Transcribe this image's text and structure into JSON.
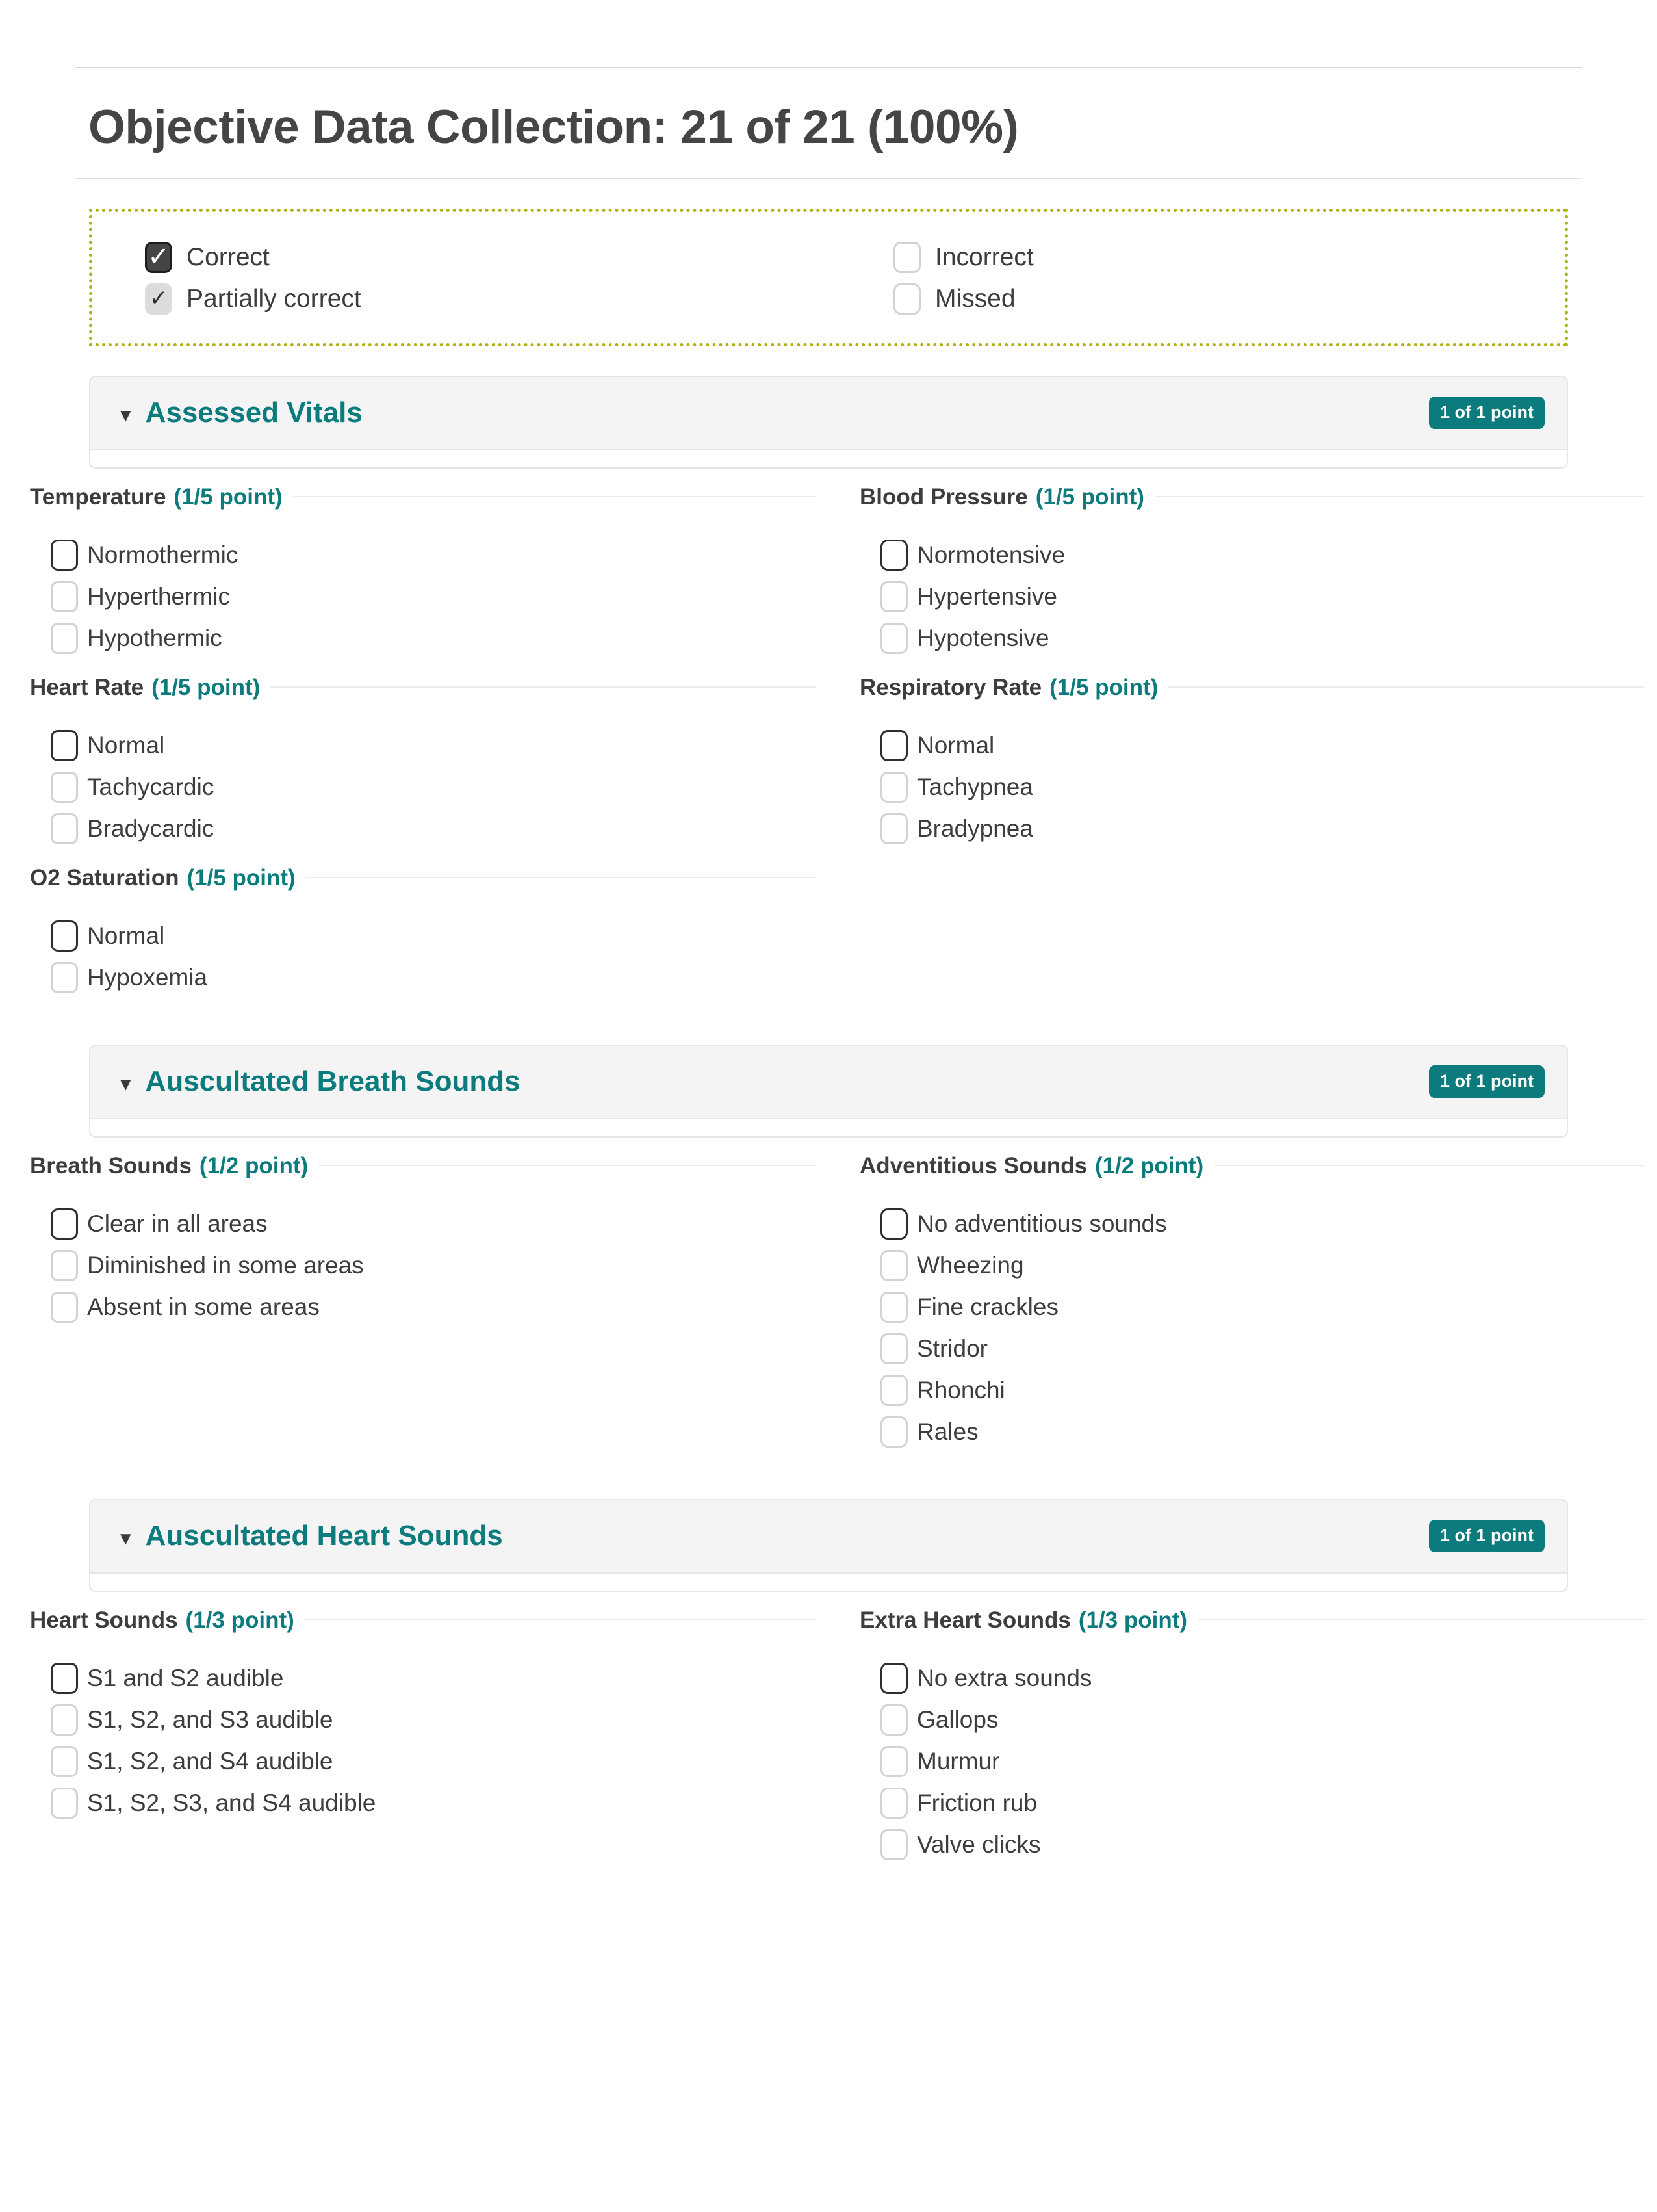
{
  "page": {
    "title": "Objective Data Collection: 21 of 21 (100%)"
  },
  "colors": {
    "accent_teal": "#0c7b7d",
    "legend_border_olive": "#b0b012",
    "panel_gray": "#f4f4f4",
    "text_dark": "#3d3d3d"
  },
  "legend": {
    "items": [
      {
        "label": "Correct",
        "state": "correct",
        "icon": "checkbox-checked-icon"
      },
      {
        "label": "Partially correct",
        "state": "partial",
        "icon": "checkbox-partial-icon"
      },
      {
        "label": "Incorrect",
        "state": "empty",
        "icon": "checkbox-empty-icon"
      },
      {
        "label": "Missed",
        "state": "empty",
        "icon": "checkbox-empty-icon"
      }
    ]
  },
  "sections": [
    {
      "title": "Assessed Vitals",
      "points_badge": "1 of 1 point",
      "chevron_icon": "chevron-down-icon",
      "groups": [
        {
          "name": "Temperature",
          "points": "(1/5 point)",
          "options": [
            "Normothermic",
            "Hyperthermic",
            "Hypothermic"
          ]
        },
        {
          "name": "Blood Pressure",
          "points": "(1/5 point)",
          "options": [
            "Normotensive",
            "Hypertensive",
            "Hypotensive"
          ]
        },
        {
          "name": "Heart Rate",
          "points": "(1/5 point)",
          "options": [
            "Normal",
            "Tachycardic",
            "Bradycardic"
          ]
        },
        {
          "name": "Respiratory Rate",
          "points": "(1/5 point)",
          "options": [
            "Normal",
            "Tachypnea",
            "Bradypnea"
          ]
        },
        {
          "name": "O2 Saturation",
          "points": "(1/5 point)",
          "options": [
            "Normal",
            "Hypoxemia"
          ]
        }
      ]
    },
    {
      "title": "Auscultated Breath Sounds",
      "points_badge": "1 of 1 point",
      "chevron_icon": "chevron-down-icon",
      "groups": [
        {
          "name": "Breath Sounds",
          "points": "(1/2 point)",
          "options": [
            "Clear in all areas",
            "Diminished in some areas",
            "Absent in some areas"
          ]
        },
        {
          "name": "Adventitious Sounds",
          "points": "(1/2 point)",
          "options": [
            "No adventitious sounds",
            "Wheezing",
            "Fine crackles",
            "Stridor",
            "Rhonchi",
            "Rales"
          ]
        }
      ]
    },
    {
      "title": "Auscultated Heart Sounds",
      "points_badge": "1 of 1 point",
      "chevron_icon": "chevron-down-icon",
      "groups": [
        {
          "name": "Heart Sounds",
          "points": "(1/3 point)",
          "options": [
            "S1 and S2 audible",
            "S1, S2, and S3 audible",
            "S1, S2, and S4 audible",
            "S1, S2, S3, and S4 audible"
          ]
        },
        {
          "name": "Extra Heart Sounds",
          "points": "(1/3 point)",
          "options": [
            "No extra sounds",
            "Gallops",
            "Murmur",
            "Friction rub",
            "Valve clicks"
          ]
        }
      ]
    }
  ]
}
